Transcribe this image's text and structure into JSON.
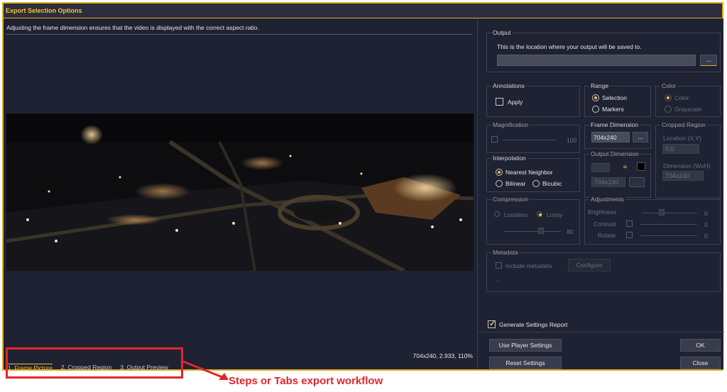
{
  "window": {
    "title": "Export Selection Options"
  },
  "left": {
    "description": "Adjusting the frame dimension ensures that the  video is displayed with the correct aspect ratio.",
    "status": "704x240, 2.933, 110%"
  },
  "steps": [
    {
      "label": "1. Frame Picture"
    },
    {
      "label": "2. Cropped Region"
    },
    {
      "label": "3. Output Preview"
    }
  ],
  "output": {
    "group_label": "Output",
    "info": "This is the location where your output will be saved to.",
    "path_value": "",
    "browse_label": "..."
  },
  "annotations": {
    "group_label": "Annotations",
    "apply_label": "Apply"
  },
  "range": {
    "group_label": "Range",
    "selection_label": "Selection",
    "markers_label": "Markers"
  },
  "color": {
    "group_label": "Color",
    "color_label": "Color",
    "grayscale_label": "Grayscale"
  },
  "magnification": {
    "group_label": "Magnification",
    "value": "100"
  },
  "frame_dimension": {
    "group_label": "Frame Dimension",
    "value": "704x240",
    "button_label": "..."
  },
  "cropped_region": {
    "group_label": "Cropped Region",
    "location_label": "Location (X,Y)",
    "location_value": "0,0",
    "dimension_label": "Dimension (WxH)",
    "dimension_value": "704x240"
  },
  "interpolation": {
    "group_label": "Interpolation",
    "nearest_label": "Nearest Neighbor",
    "bilinear_label": "Bilinear",
    "bicubic_label": "Bicubic"
  },
  "output_dimension": {
    "group_label": "Output Dimension",
    "value": "704x240",
    "button_label": "..."
  },
  "compression": {
    "group_label": "Compression",
    "lossless_label": "Lossless",
    "lossy_label": "Lossy",
    "value": "80"
  },
  "adjustments": {
    "group_label": "Adjustments",
    "brightness_label": "Brightness",
    "brightness_value": "0",
    "contrast_label": "Contrast",
    "contrast_value": "0",
    "rotate_label": "Rotate",
    "rotate_value": "0"
  },
  "metadata": {
    "group_label": "Metadata",
    "include_label": "Include metadata",
    "configure_label": "Configure",
    "extra": "..."
  },
  "report": {
    "label": "Generate Settings Report",
    "checked": true
  },
  "buttons": {
    "use_player": "Use Player Settings",
    "reset": "Reset Settings",
    "ok": "OK",
    "close": "Close"
  },
  "callout": {
    "text": "Steps or Tabs export workflow"
  },
  "colors": {
    "accent": "#f3c233",
    "border": "#e2ac23",
    "background": "#1f2233",
    "callout": "#e3242b"
  }
}
